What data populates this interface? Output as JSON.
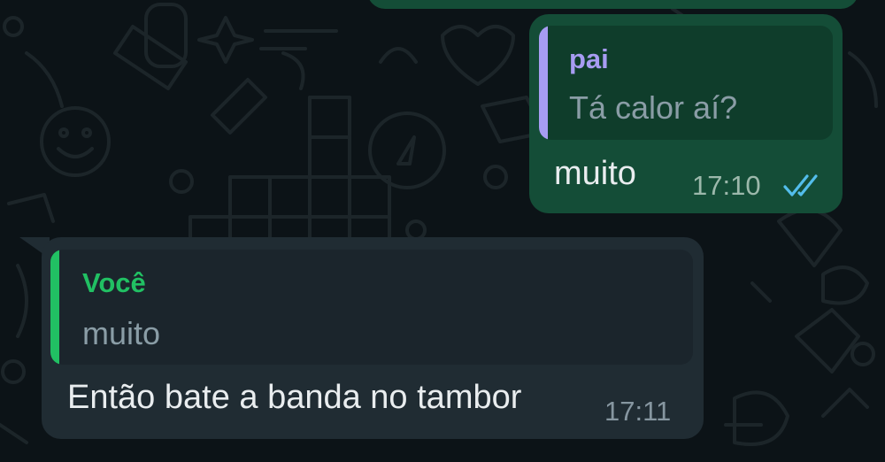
{
  "theme": {
    "background": "#0c1317",
    "outgoing_bubble": "#144d37",
    "incoming_bubble": "#202c33",
    "read_ticks": "#53bdeb",
    "quote_author_pai": "#a79cf2",
    "quote_author_voce": "#21c063"
  },
  "messages": [
    {
      "direction": "outgoing",
      "quoted": {
        "author": "pai",
        "text": "Tá calor aí?"
      },
      "text": "muito",
      "time": "17:10",
      "status_icon": "double-check-read-icon"
    },
    {
      "direction": "incoming",
      "quoted": {
        "author": "Você",
        "text": "muito"
      },
      "text": "Então bate a banda no tambor",
      "time": "17:11"
    }
  ]
}
